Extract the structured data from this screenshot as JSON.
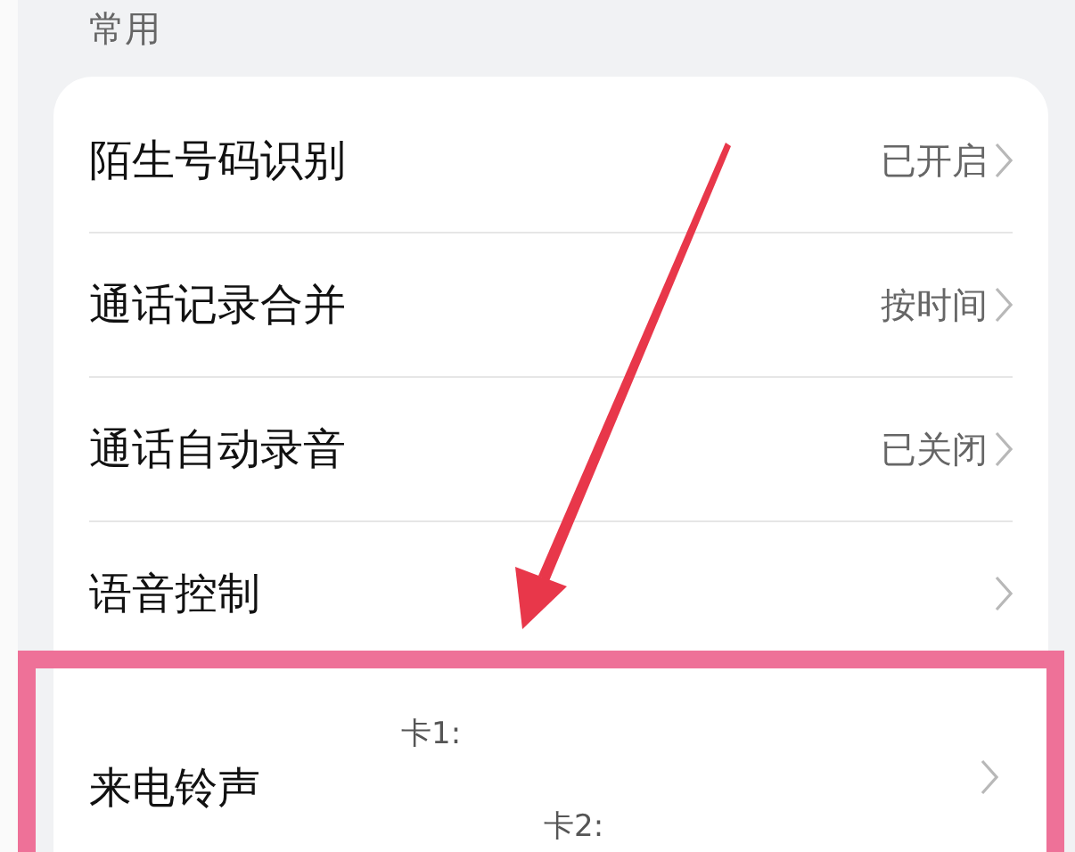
{
  "section_title": "常用",
  "rows": [
    {
      "kind": "value",
      "label": "陌生号码识别",
      "value": "已开启"
    },
    {
      "kind": "value",
      "label": "通话记录合并",
      "value": "按时间"
    },
    {
      "kind": "value",
      "label": "通话自动录音",
      "value": "已关闭"
    },
    {
      "kind": "value",
      "label": "语音控制"
    },
    {
      "kind": "cards",
      "label": "来电铃声",
      "cards": [
        "卡1:",
        "卡2:"
      ]
    }
  ]
}
